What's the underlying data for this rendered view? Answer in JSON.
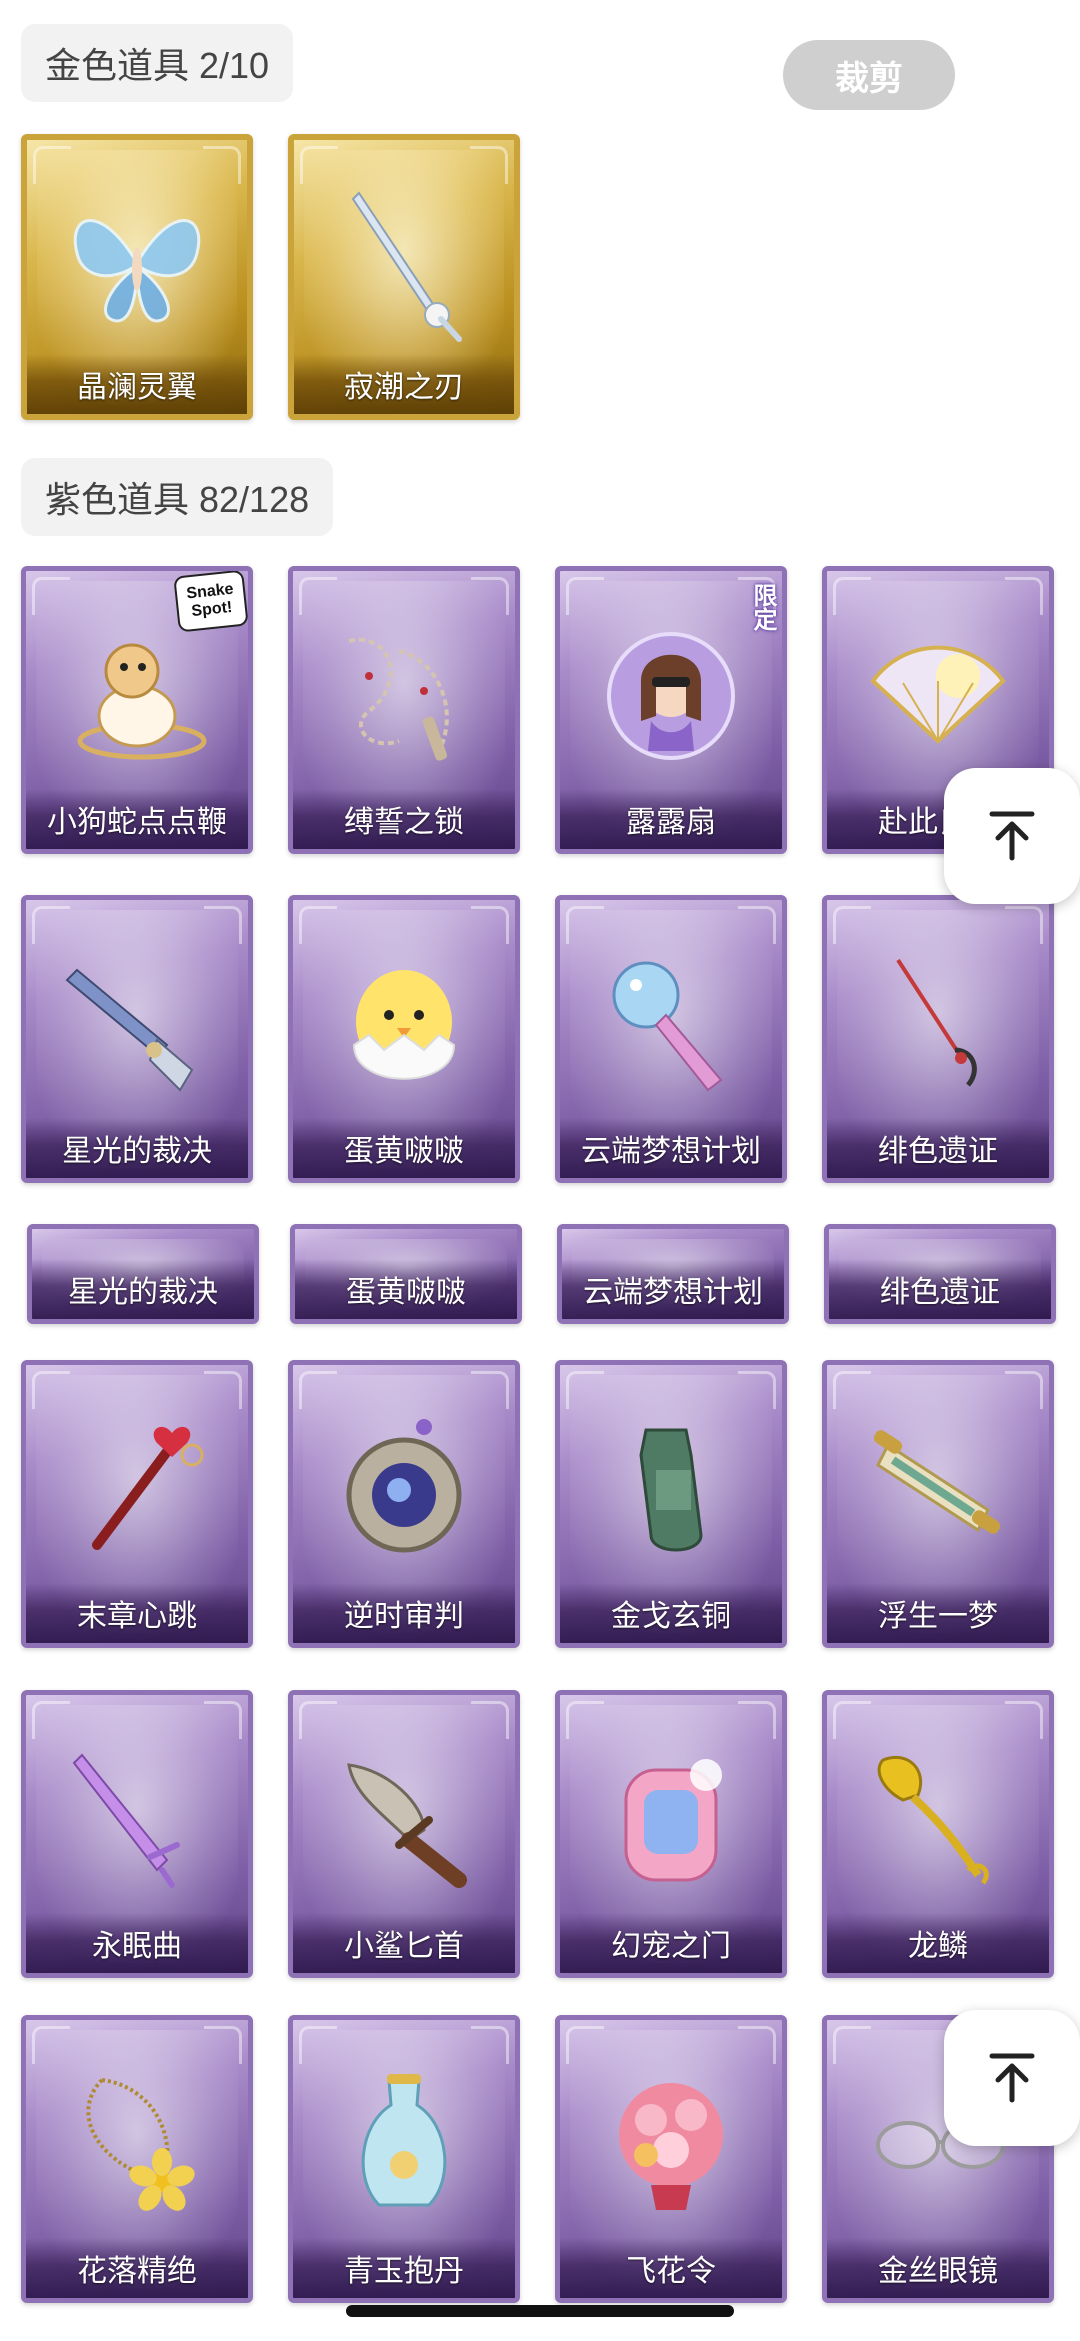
{
  "gold_section": {
    "title": "金色道具 2/10"
  },
  "crop_button": {
    "label": "裁剪"
  },
  "gold_items": [
    {
      "name": "晶澜灵翼",
      "icon": "butterfly-wings-icon"
    },
    {
      "name": "寂潮之刃",
      "icon": "blade-icon"
    }
  ],
  "purple_section": {
    "title": "紫色道具 82/128"
  },
  "purple_items": [
    {
      "name": "小狗蛇点点鞭",
      "icon": "snake-whip-icon",
      "badge": "Snake Spot!"
    },
    {
      "name": "缚誓之锁",
      "icon": "chain-lock-icon"
    },
    {
      "name": "露露扇",
      "icon": "girl-fan-icon",
      "badge": "限定"
    },
    {
      "name": "赴此良宵",
      "icon": "golden-fan-icon"
    },
    {
      "name": "星光的裁决",
      "icon": "shotgun-icon"
    },
    {
      "name": "蛋黄啵啵",
      "icon": "chick-egg-icon"
    },
    {
      "name": "云端梦想计划",
      "icon": "magic-wand-icon"
    },
    {
      "name": "绯色遗证",
      "icon": "rapier-icon"
    },
    {
      "name": "星光的裁决",
      "icon": "shotgun-icon"
    },
    {
      "name": "蛋黄啵啵",
      "icon": "chick-egg-icon"
    },
    {
      "name": "云端梦想计划",
      "icon": "magic-wand-icon"
    },
    {
      "name": "绯色遗证",
      "icon": "rapier-icon"
    },
    {
      "name": "末章心跳",
      "icon": "heart-scepter-icon"
    },
    {
      "name": "逆时审判",
      "icon": "pocket-watch-icon"
    },
    {
      "name": "金戈玄铜",
      "icon": "bronze-relic-icon"
    },
    {
      "name": "浮生一梦",
      "icon": "scroll-icon"
    },
    {
      "name": "永眠曲",
      "icon": "crystal-sword-icon"
    },
    {
      "name": "小鲨匕首",
      "icon": "shark-dagger-icon"
    },
    {
      "name": "幻宠之门",
      "icon": "pet-device-icon"
    },
    {
      "name": "龙鳞",
      "icon": "golden-shovel-icon"
    },
    {
      "name": "花落精绝",
      "icon": "flower-necklace-icon"
    },
    {
      "name": "青玉抱丹",
      "icon": "jade-vase-icon"
    },
    {
      "name": "飞花令",
      "icon": "flower-bouquet-icon"
    },
    {
      "name": "金丝眼镜",
      "icon": "glasses-icon"
    }
  ],
  "float_buttons": [
    {
      "icon": "back-to-top-icon"
    },
    {
      "icon": "back-to-top-icon"
    }
  ],
  "colors": {
    "gold_card": "#d9b64c",
    "purple_card": "#8e72b5",
    "header_bg": "#f2f2f2",
    "crop_button_bg": "#cfcfcf"
  }
}
